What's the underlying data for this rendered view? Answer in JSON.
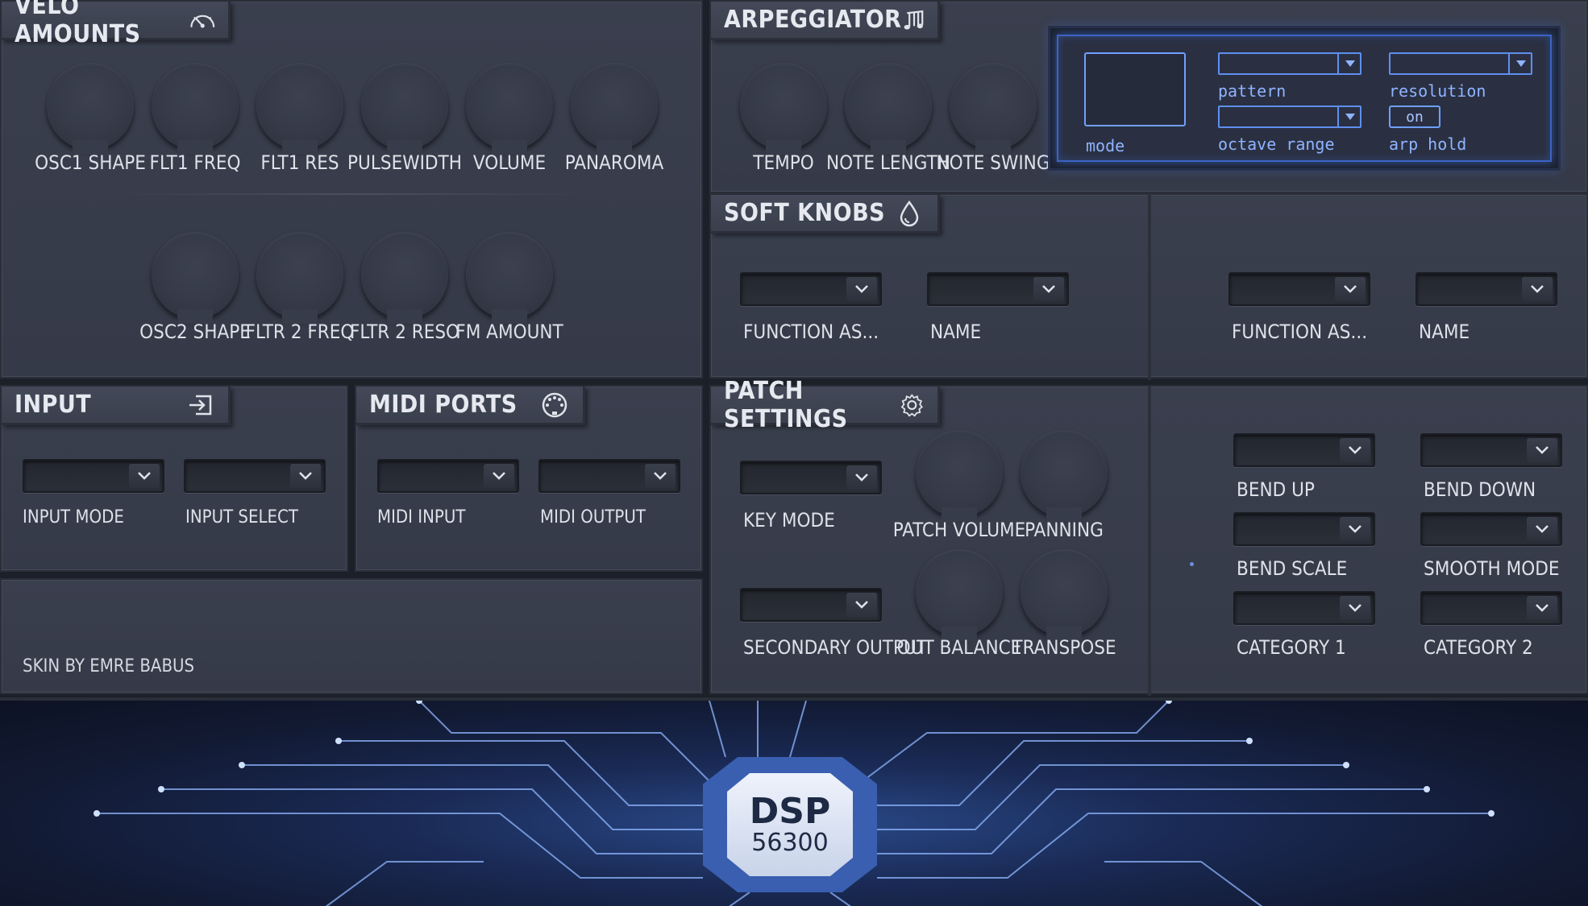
{
  "velo": {
    "title": "VELO AMOUNTS",
    "icon": "gauge-icon",
    "knobs_row1": [
      "OSC1 SHAPE",
      "FLT1 FREQ",
      "FLT1 RES",
      "PULSEWIDTH",
      "VOLUME",
      "PANAROMA"
    ],
    "knobs_row2": [
      "OSC2 SHAPE",
      "FLTR 2 FREQ",
      "FLTR 2 RESO",
      "FM AMOUNT"
    ]
  },
  "arp": {
    "title": "ARPEGGIATOR",
    "icon": "music-notes-icon",
    "knobs": [
      "TEMPO",
      "NOTE LENGTH",
      "NOTE SWING"
    ],
    "mode_label": "mode",
    "pattern_label": "pattern",
    "resolution_label": "resolution",
    "octave_label": "octave range",
    "arphold_label": "arp hold",
    "arphold_value": "on"
  },
  "soft": {
    "title": "SOFT KNOBS",
    "icon": "drop-icon",
    "labels": [
      "FUNCTION  AS...",
      "NAME",
      "FUNCTION  AS...",
      "NAME"
    ]
  },
  "input": {
    "title": "INPUT",
    "icon": "input-arrow-icon",
    "labels": [
      "INPUT MODE",
      "INPUT SELECT"
    ]
  },
  "midi": {
    "title": "MIDI PORTS",
    "icon": "midi-port-icon",
    "labels": [
      "MIDI INPUT",
      "MIDI OUTPUT"
    ]
  },
  "patch": {
    "title": "PATCH SETTINGS",
    "icon": "gear-icon",
    "key_mode": "KEY MODE",
    "secondary_output": "SECONDARY OUTPUT",
    "knobs": [
      "PATCH VOLUME",
      "PANNING",
      "OUT BALANCE",
      "TRANSPOSE"
    ],
    "right_labels": [
      "BEND UP",
      "BEND DOWN",
      "BEND SCALE",
      "SMOOTH MODE",
      "CATEGORY 1",
      "CATEGORY 2"
    ]
  },
  "credit": "SKIN BY EMRE BABUS",
  "banner": {
    "chip_title": "DSP",
    "chip_number": "56300"
  },
  "colors": {
    "panel": "#383d4b",
    "accent_blue": "#6fa0ff",
    "text": "#dde1e8"
  }
}
